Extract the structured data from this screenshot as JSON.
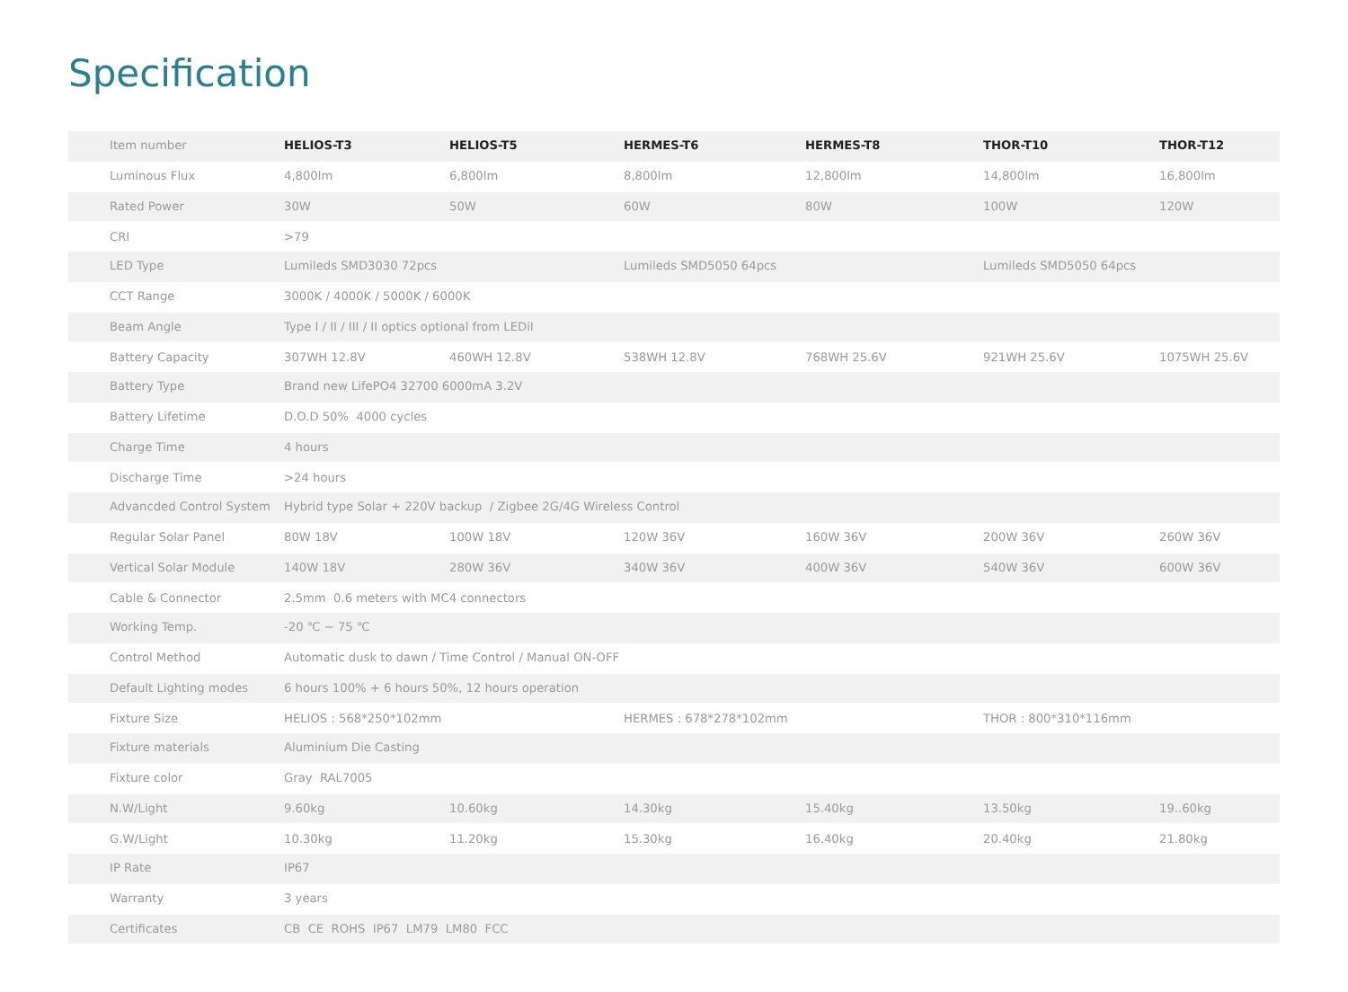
{
  "title": "Specification",
  "table": {
    "columns": [
      "Item number",
      "HELIOS-T3",
      "HELIOS-T5",
      "HERMES-T6",
      "HERMES-T8",
      "THOR-T10",
      "THOR-T12"
    ],
    "rows": [
      {
        "cells": [
          "Luminous Flux",
          "4,800lm",
          "6,800lm",
          "8,800lm",
          "12,800lm",
          "14,800lm",
          "16,800lm"
        ]
      },
      {
        "cells": [
          "Rated Power",
          "30W",
          "50W",
          "60W",
          "80W",
          "100W",
          "120W"
        ]
      },
      {
        "cells": [
          "CRI",
          ">79",
          "",
          "",
          "",
          "",
          ""
        ]
      },
      {
        "cells": [
          "LED Type",
          "Lumileds SMD3030 72pcs",
          "",
          "Lumileds SMD5050 64pcs",
          "",
          "Lumileds SMD5050 64pcs",
          ""
        ]
      },
      {
        "cells": [
          "CCT Range",
          "3000K / 4000K / 5000K / 6000K",
          "",
          "",
          "",
          "",
          ""
        ]
      },
      {
        "cells": [
          "Beam Angle",
          "Type I / II / III / II optics optional from LEDiI",
          "",
          "",
          "",
          "",
          ""
        ]
      },
      {
        "cells": [
          "Battery Capacity",
          "307WH 12.8V",
          "460WH 12.8V",
          "538WH 12.8V",
          "768WH 25.6V",
          "921WH 25.6V",
          "1075WH 25.6V"
        ]
      },
      {
        "cells": [
          "Battery Type",
          "Brand new LifePO4 32700 6000mA 3.2V",
          "",
          "",
          "",
          "",
          ""
        ]
      },
      {
        "cells": [
          "Battery Lifetime",
          "D.O.D 50%  4000 cycles",
          "",
          "",
          "",
          "",
          ""
        ]
      },
      {
        "cells": [
          "Charge Time",
          "4 hours",
          "",
          "",
          "",
          "",
          ""
        ]
      },
      {
        "cells": [
          "Discharge Time",
          ">24 hours",
          "",
          "",
          "",
          "",
          ""
        ]
      },
      {
        "cells": [
          "Advancded Control System",
          "Hybrid type Solar + 220V backup  / Zigbee 2G/4G Wireless Control",
          "",
          "",
          "",
          "",
          ""
        ]
      },
      {
        "cells": [
          "Regular Solar Panel",
          "80W 18V",
          "100W 18V",
          "120W 36V",
          "160W 36V",
          "200W 36V",
          "260W 36V"
        ]
      },
      {
        "cells": [
          "Vertical Solar Module",
          "140W 18V",
          "280W 36V",
          "340W 36V",
          "400W 36V",
          "540W 36V",
          "600W 36V"
        ]
      },
      {
        "cells": [
          "Cable & Connector",
          "2.5mm  0.6 meters with MC4 connectors",
          "",
          "",
          "",
          "",
          ""
        ]
      },
      {
        "cells": [
          "Working Temp.",
          "-20 ℃ ~ 75 ℃",
          "",
          "",
          "",
          "",
          ""
        ]
      },
      {
        "cells": [
          "Control Method",
          "Automatic dusk to dawn / Time Control / Manual ON-OFF",
          "",
          "",
          "",
          "",
          ""
        ]
      },
      {
        "cells": [
          "Default Lighting modes",
          "6 hours 100% + 6 hours 50%, 12 hours operation",
          "",
          "",
          "",
          "",
          ""
        ]
      },
      {
        "cells": [
          "Fixture Size",
          "HELIOS : 568*250*102mm",
          "",
          "HERMES : 678*278*102mm",
          "",
          "THOR : 800*310*116mm",
          ""
        ]
      },
      {
        "cells": [
          "Fixture materials",
          "Aluminium Die Casting",
          "",
          "",
          "",
          "",
          ""
        ]
      },
      {
        "cells": [
          "Fixture color",
          "Gray  RAL7005",
          "",
          "",
          "",
          "",
          ""
        ]
      },
      {
        "cells": [
          "N.W/Light",
          "9.60kg",
          "10.60kg",
          "14.30kg",
          "15.40kg",
          "13.50kg",
          "19..60kg"
        ]
      },
      {
        "cells": [
          "G.W/Light",
          "10.30kg",
          "11.20kg",
          "15.30kg",
          "16.40kg",
          "20.40kg",
          "21.80kg"
        ]
      },
      {
        "cells": [
          "IP Rate",
          "IP67",
          "",
          "",
          "",
          "",
          ""
        ]
      },
      {
        "cells": [
          "Warranty",
          "3 years",
          "",
          "",
          "",
          "",
          ""
        ]
      },
      {
        "cells": [
          "Certificates",
          "CB  CE  ROHS  IP67  LM79  LM80  FCC",
          "",
          "",
          "",
          "",
          ""
        ]
      }
    ]
  }
}
